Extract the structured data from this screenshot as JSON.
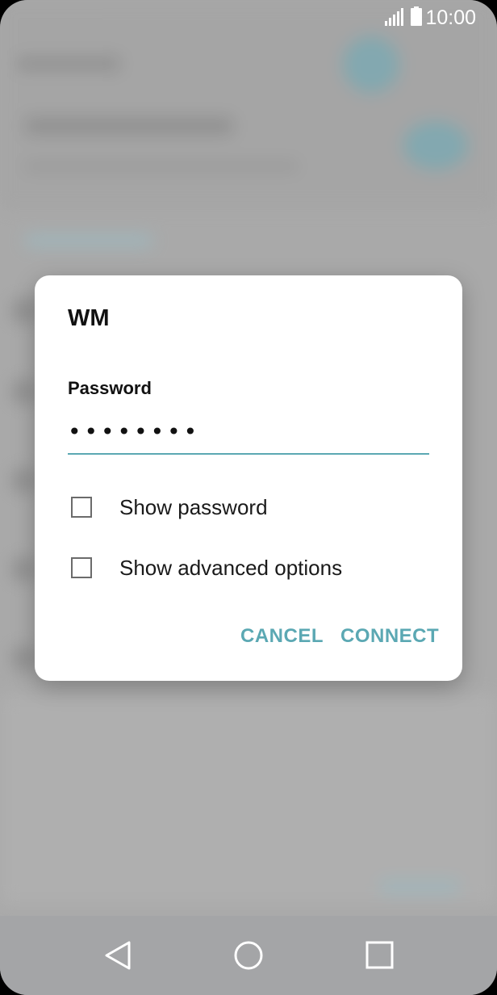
{
  "status_bar": {
    "time": "10:00",
    "signal_icon": "signal-icon",
    "battery_icon": "battery-icon"
  },
  "dialog": {
    "title": "WM",
    "password_label": "Password",
    "password_value": "••••••••",
    "show_password_label": "Show password",
    "show_advanced_label": "Show advanced options",
    "cancel_label": "CANCEL",
    "connect_label": "CONNECT"
  },
  "nav_bar": {
    "back_icon": "back-icon",
    "home_icon": "home-icon",
    "recent_icon": "recent-apps-icon"
  },
  "colors": {
    "accent": "#5ba8b3",
    "scrim": "#a9a9a9",
    "dialog_bg": "#ffffff"
  }
}
